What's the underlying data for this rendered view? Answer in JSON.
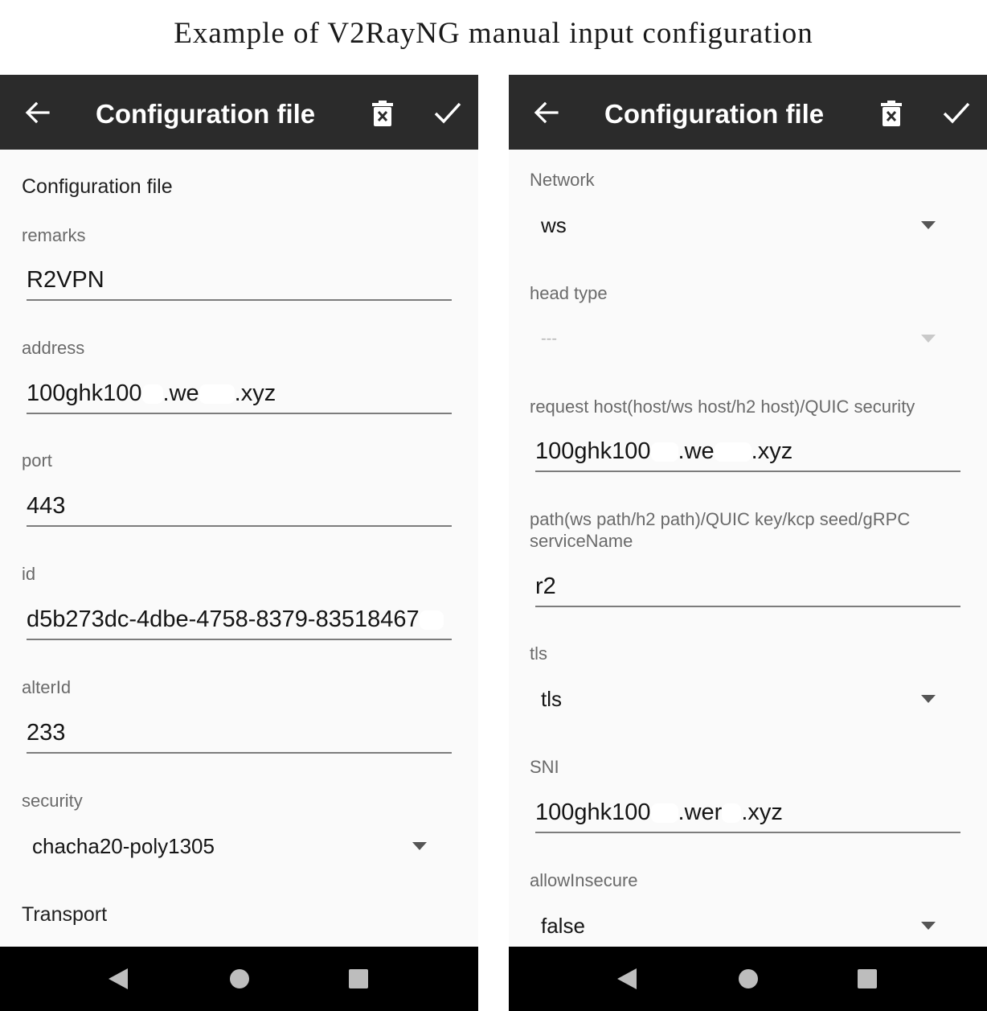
{
  "page_title": "Example of  V2RayNG manual input configuration",
  "appbar": {
    "title": "Configuration file",
    "icons": {
      "back": "arrow-back-icon",
      "delete": "trash-icon",
      "save": "check-icon"
    },
    "background": "#2b2b2b"
  },
  "left_screen": {
    "section_title": "Configuration file",
    "fields": {
      "remarks": {
        "label": "remarks",
        "value": "R2VPN"
      },
      "address": {
        "label": "address",
        "value_start": "100ghk100",
        "value_mid": ".we",
        "value_end": ".xyz"
      },
      "port": {
        "label": "port",
        "value": "443"
      },
      "id": {
        "label": "id",
        "value": "d5b273dc-4dbe-4758-8379-83518467"
      },
      "alterId": {
        "label": "alterId",
        "value": "233"
      },
      "security": {
        "label": "security",
        "value": "chacha20-poly1305"
      }
    },
    "transport_title": "Transport"
  },
  "right_screen": {
    "fields": {
      "network": {
        "label": "Network",
        "value": "ws"
      },
      "head_type": {
        "label": "head type",
        "value": "---"
      },
      "request_host": {
        "label": "request host(host/ws host/h2 host)/QUIC security",
        "value_start": "100ghk100",
        "value_mid": ".we",
        "value_end": ".xyz"
      },
      "path": {
        "label": "path(ws path/h2 path)/QUIC key/kcp seed/gRPC serviceName",
        "value": "r2"
      },
      "tls": {
        "label": "tls",
        "value": "tls"
      },
      "sni": {
        "label": "SNI",
        "value_start": "100ghk100",
        "value_mid": ".wer",
        "value_end": ".xyz"
      },
      "allow_insecure": {
        "label": "allowInsecure",
        "value": "false"
      }
    }
  },
  "navbar": {
    "icons": [
      "nav-back-icon",
      "nav-home-icon",
      "nav-recents-icon"
    ]
  }
}
